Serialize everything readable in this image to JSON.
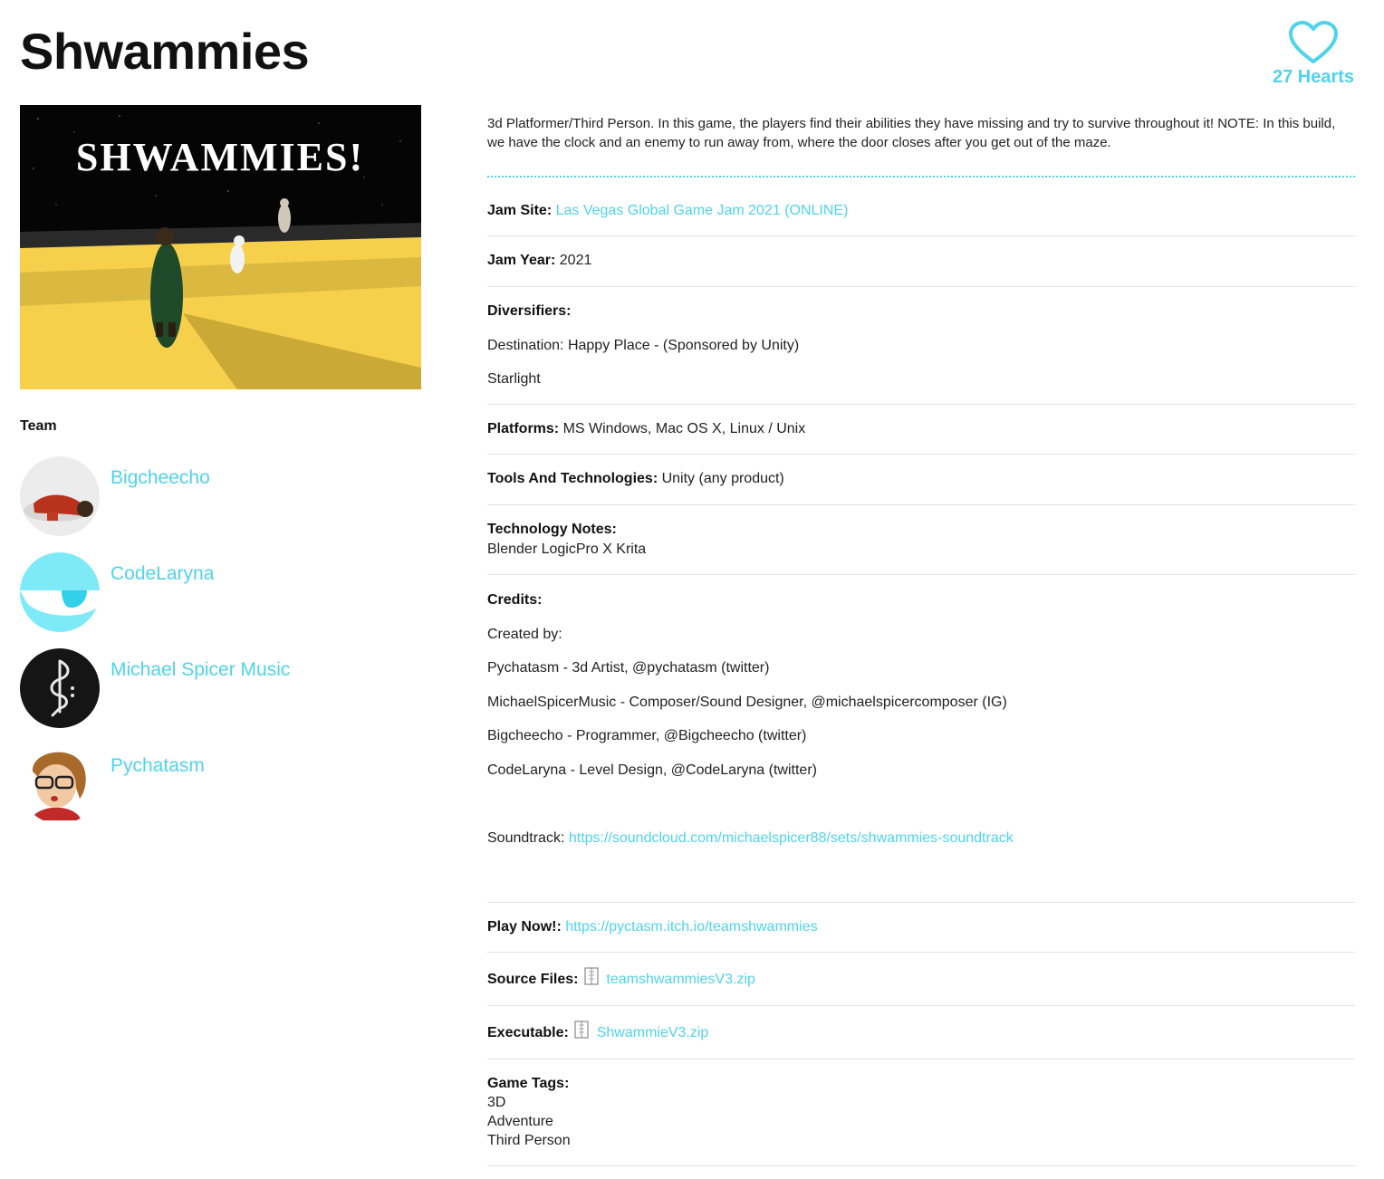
{
  "game": {
    "title": "Shwammies",
    "hearts_label": "27 Hearts",
    "description": "3d Platformer/Third Person. In this game, the players find their abilities they have missing and try to survive throughout it! NOTE: In this build, we have the clock and an enemy to run away from, where the door closes after you get out of the maze.",
    "cover_text": "SHWAMMIES!"
  },
  "team": {
    "heading": "Team",
    "members": [
      {
        "name": "Bigcheecho"
      },
      {
        "name": "CodeLaryna"
      },
      {
        "name": "Michael Spicer Music"
      },
      {
        "name": "Pychatasm"
      }
    ]
  },
  "details": {
    "jam_site": {
      "label": "Jam Site:",
      "value": "Las Vegas Global Game Jam 2021 (ONLINE)"
    },
    "jam_year": {
      "label": "Jam Year:",
      "value": "2021"
    },
    "diversifiers": {
      "label": "Diversifiers:",
      "items": [
        "Destination: Happy Place - (Sponsored by Unity)",
        "Starlight"
      ]
    },
    "platforms": {
      "label": "Platforms:",
      "value": "MS Windows, Mac OS X, Linux / Unix"
    },
    "tools": {
      "label": "Tools And Technologies:",
      "value": "Unity (any product)"
    },
    "tech_notes": {
      "label": "Technology Notes:",
      "value": "Blender LogicPro X Krita"
    },
    "credits": {
      "label": "Credits:",
      "lines": [
        "Created by:",
        "Pychatasm - 3d Artist, @pychatasm (twitter)",
        "MichaelSpicerMusic - Composer/Sound Designer, @michaelspicercomposer (IG)",
        "Bigcheecho - Programmer, @Bigcheecho (twitter)",
        "CodeLaryna - Level Design, @CodeLaryna (twitter)"
      ],
      "soundtrack_label": "Soundtrack:",
      "soundtrack_url": "https://soundcloud.com/michaelspicer88/sets/shwammies-soundtrack"
    },
    "play_now": {
      "label": "Play Now!:",
      "url": "https://pyctasm.itch.io/teamshwammies"
    },
    "source_files": {
      "label": "Source Files:",
      "file": "teamshwammiesV3.zip"
    },
    "executable": {
      "label": "Executable:",
      "file": "ShwammieV3.zip"
    },
    "game_tags": {
      "label": "Game Tags:",
      "tags": [
        "3D",
        "Adventure",
        "Third Person"
      ]
    }
  },
  "colors": {
    "accent": "#4fd3ea",
    "text": "#111111",
    "divider": "#e4e4e4"
  },
  "icons": [
    "heart-outline-icon",
    "zip-file-icon"
  ]
}
